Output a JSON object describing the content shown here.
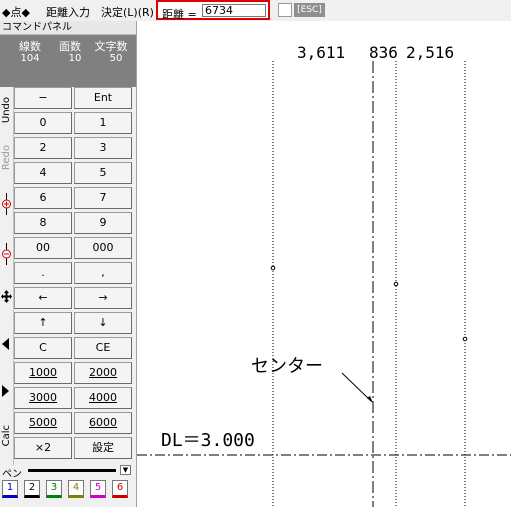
{
  "toolbar": {
    "mode": "◆点◆",
    "title": "距離入力",
    "confirm": "決定(L)(R)",
    "distance_label": "距離 =",
    "distance_value": "6734",
    "esc_label": "[ESC]"
  },
  "panel": {
    "title": "コマンドパネル",
    "stats": {
      "lines_label": "線数",
      "lines_value": "104",
      "faces_label": "面数",
      "faces_value": "10",
      "chars_label": "文字数",
      "chars_value": "50"
    },
    "side_tabs": [
      "Undo",
      "Redo",
      "Calc"
    ],
    "keys": [
      [
        "−",
        "Ent"
      ],
      [
        "0",
        "1"
      ],
      [
        "2",
        "3"
      ],
      [
        "4",
        "5"
      ],
      [
        "6",
        "7"
      ],
      [
        "8",
        "9"
      ],
      [
        "00",
        "000"
      ],
      [
        ".",
        ","
      ],
      [
        "←",
        "→"
      ],
      [
        "↑",
        "↓"
      ],
      [
        "C",
        "CE"
      ],
      [
        "1000",
        "2000"
      ],
      [
        "3000",
        "4000"
      ],
      [
        "5000",
        "6000"
      ],
      [
        "×2",
        "設定"
      ]
    ],
    "pen_label": "ペン",
    "pens": [
      {
        "label": "1",
        "color": "#0000cc"
      },
      {
        "label": "2",
        "color": "#000000"
      },
      {
        "label": "3",
        "color": "#008000"
      },
      {
        "label": "4",
        "color": "#808000"
      },
      {
        "label": "5",
        "color": "#cc00cc"
      },
      {
        "label": "6",
        "color": "#cc0000"
      }
    ]
  },
  "canvas": {
    "dim1": "3,611",
    "dim2": "836",
    "dim3": "2,516",
    "center_label": "センター",
    "dl_label": "DL＝3.000"
  }
}
